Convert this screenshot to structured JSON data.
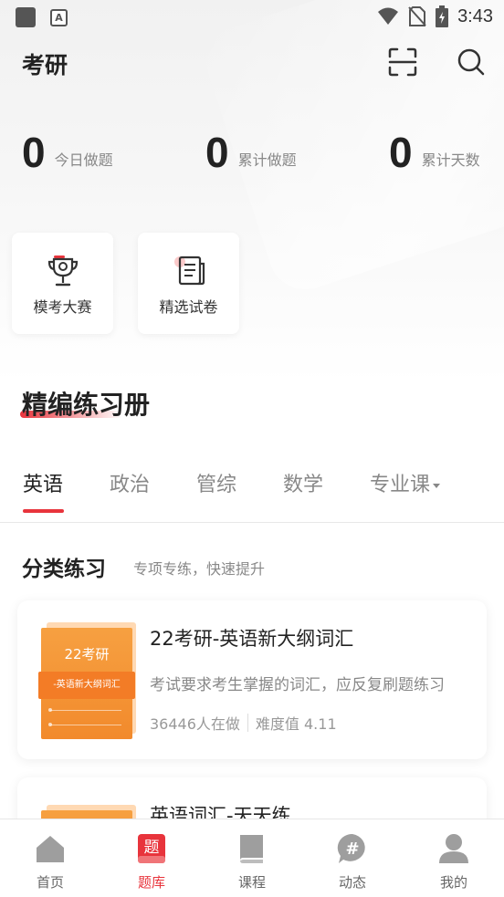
{
  "status_bar": {
    "time": "3:43"
  },
  "header": {
    "title": "考研"
  },
  "stats": [
    {
      "value": "0",
      "label": "今日做题"
    },
    {
      "value": "0",
      "label": "累计做题"
    },
    {
      "value": "0",
      "label": "累计天数"
    }
  ],
  "quick_cards": [
    {
      "label": "模考大赛",
      "icon": "trophy-icon"
    },
    {
      "label": "精选试卷",
      "icon": "paper-icon"
    }
  ],
  "section": {
    "title": "精编练习册"
  },
  "tabs": [
    {
      "label": "英语",
      "active": true
    },
    {
      "label": "政治",
      "active": false
    },
    {
      "label": "管综",
      "active": false
    },
    {
      "label": "数学",
      "active": false
    },
    {
      "label": "专业课",
      "active": false
    }
  ],
  "category": {
    "title": "分类练习",
    "subtitle": "专项专练，快速提升"
  },
  "books": [
    {
      "cover_title": "22考研",
      "cover_band": "-英语新大纲词汇",
      "title": "22考研-英语新大纲词汇",
      "desc": "考试要求考生掌握的词汇，应反复刷题练习",
      "count": "36446人在做",
      "difficulty": "难度值 4.11"
    },
    {
      "title": "英语词汇-天天练"
    }
  ],
  "bottom_nav": [
    {
      "label": "首页",
      "icon": "home-icon",
      "active": false
    },
    {
      "label": "题库",
      "icon": "question-bank-icon",
      "active": true,
      "glyph": "题"
    },
    {
      "label": "课程",
      "icon": "book-icon",
      "active": false
    },
    {
      "label": "动态",
      "icon": "hashtag-icon",
      "active": false,
      "glyph": "#"
    },
    {
      "label": "我的",
      "icon": "user-icon",
      "active": false
    }
  ],
  "colors": {
    "accent": "#e8343c",
    "book_orange": "#f28a2c"
  }
}
